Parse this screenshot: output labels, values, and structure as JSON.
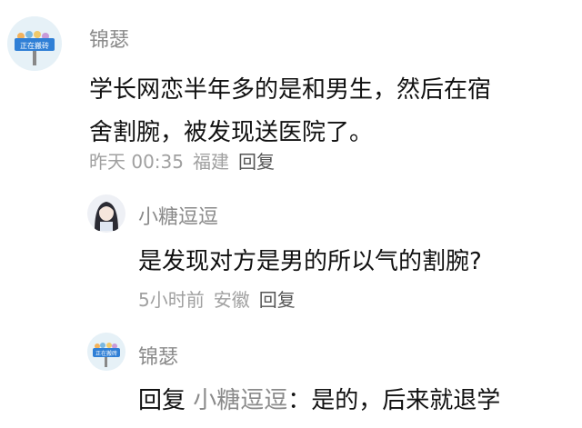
{
  "comments": [
    {
      "author": "锦瑟",
      "avatar_sign": "正在搬砖",
      "text_line1": "学长网恋半年多的是和男生，然后在宿",
      "text_line2": "舍割腕，被发现送医院了。",
      "time": "昨天 00:35",
      "location": "福建",
      "reply_label": "回复"
    },
    {
      "author": "小糖逗逗",
      "text": "是发现对方是男的所以气的割腕?",
      "time": "5小时前",
      "location": "安徽",
      "reply_label": "回复"
    },
    {
      "author": "锦瑟",
      "avatar_sign": "正在搬砖",
      "reply_prefix": "回复",
      "mention": "小糖逗逗",
      "text": "：是的，后来就退学"
    }
  ]
}
